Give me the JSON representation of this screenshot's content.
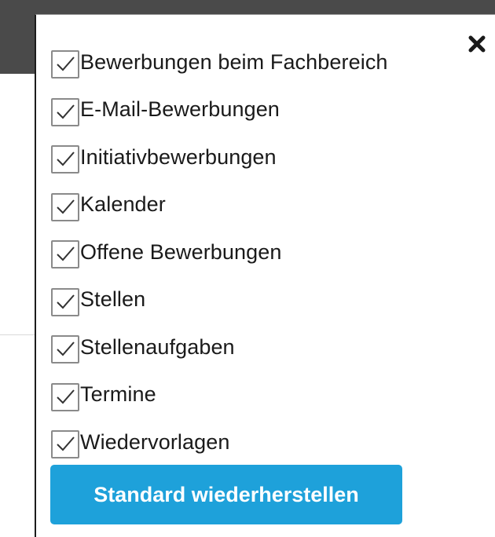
{
  "colors": {
    "header_bar": "#4a4a4a",
    "accent_button": "#1ea1da",
    "checkbox_border": "#8a8a8a",
    "checkmark": "#333333"
  },
  "popup": {
    "close_icon": "close-icon",
    "options": [
      {
        "label": "Bewerbungen beim Fachbereich",
        "checked": true
      },
      {
        "label": "E-Mail-Bewerbungen",
        "checked": true
      },
      {
        "label": "Initiativbewerbungen",
        "checked": true
      },
      {
        "label": "Kalender",
        "checked": true
      },
      {
        "label": "Offene Bewerbungen",
        "checked": true
      },
      {
        "label": "Stellen",
        "checked": true
      },
      {
        "label": "Stellenaufgaben",
        "checked": true
      },
      {
        "label": "Termine",
        "checked": true
      },
      {
        "label": "Wiedervorlagen",
        "checked": true
      }
    ],
    "restore_button_label": "Standard wiederherstellen"
  }
}
